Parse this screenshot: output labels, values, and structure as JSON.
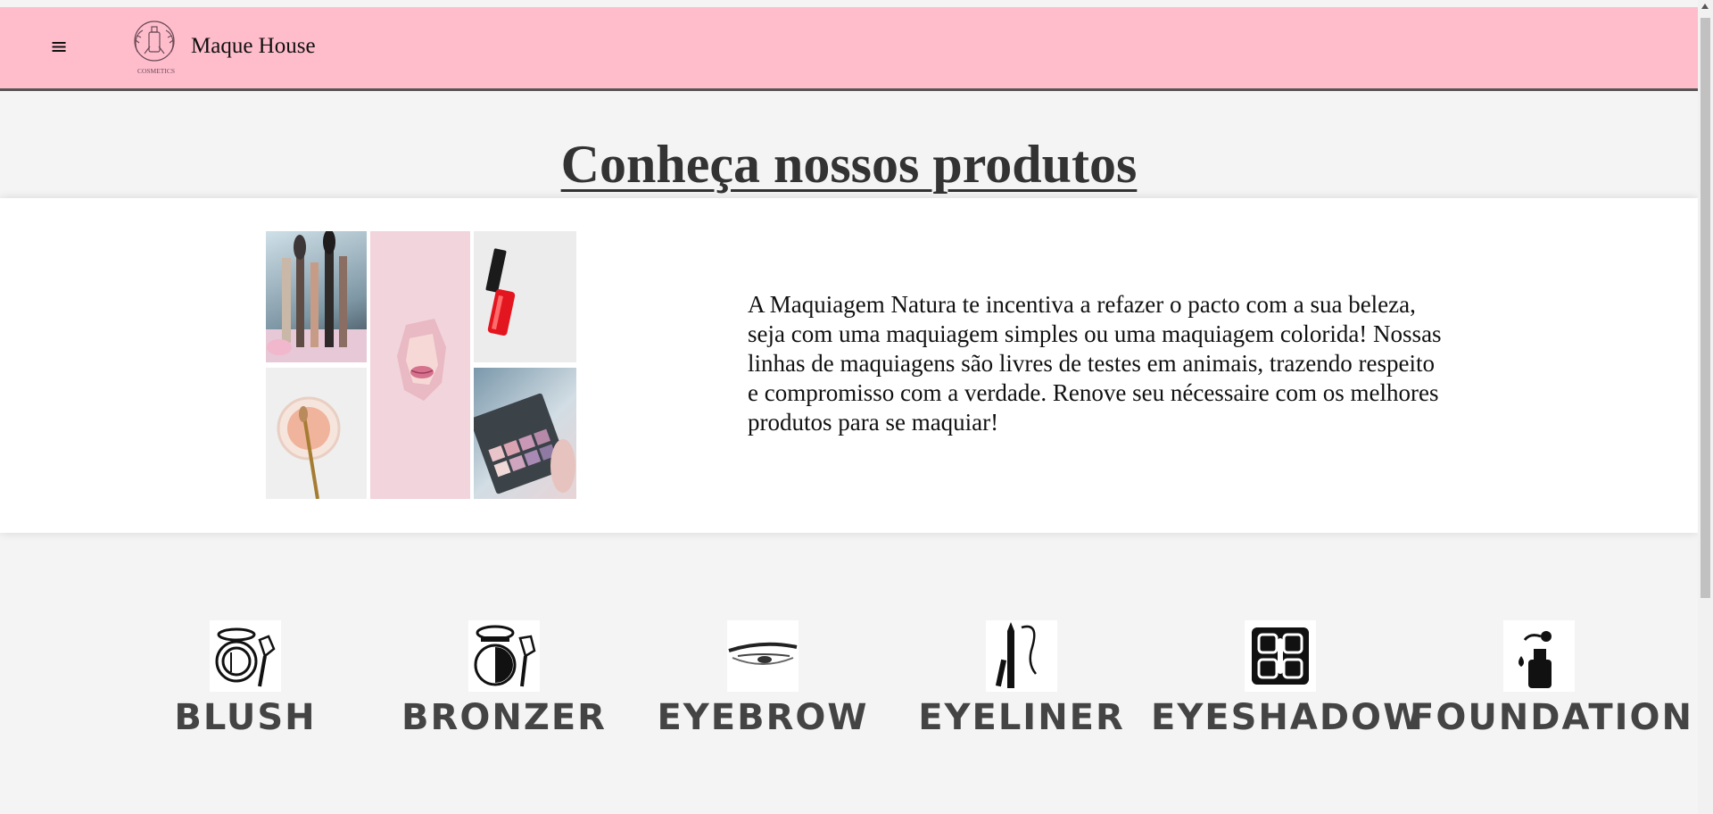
{
  "header": {
    "menu_icon": "≡",
    "logo_text": "COSMETICS",
    "brand": "Maque House",
    "background": "#ffbdcc"
  },
  "main": {
    "title": "Conheça nossos produtos",
    "description": "A Maquiagem Natura te incentiva a refazer o pacto com a sua beleza, seja com uma maquiagem simples ou uma maquiagem colorida! Nossas linhas de maquiagens são livres de testes em animais, trazendo respeito e compromisso com a verdade. Renove seu nécessaire com os melhores produtos para se maquiar!",
    "collage": [
      "makeup-brushes-photo",
      "lips-paper-photo",
      "nail-polish-photo",
      "blush-brush-photo",
      "eyeshadow-palette-photo"
    ]
  },
  "categories": [
    {
      "label": "BLUSH",
      "icon": "blush-icon"
    },
    {
      "label": "BRONZER",
      "icon": "bronzer-icon"
    },
    {
      "label": "EYEBROW",
      "icon": "eyebrow-icon"
    },
    {
      "label": "EYELINER",
      "icon": "eyeliner-icon"
    },
    {
      "label": "EYESHADOW",
      "icon": "eyeshadow-icon"
    },
    {
      "label": "FOUNDATION",
      "icon": "foundation-icon"
    }
  ]
}
